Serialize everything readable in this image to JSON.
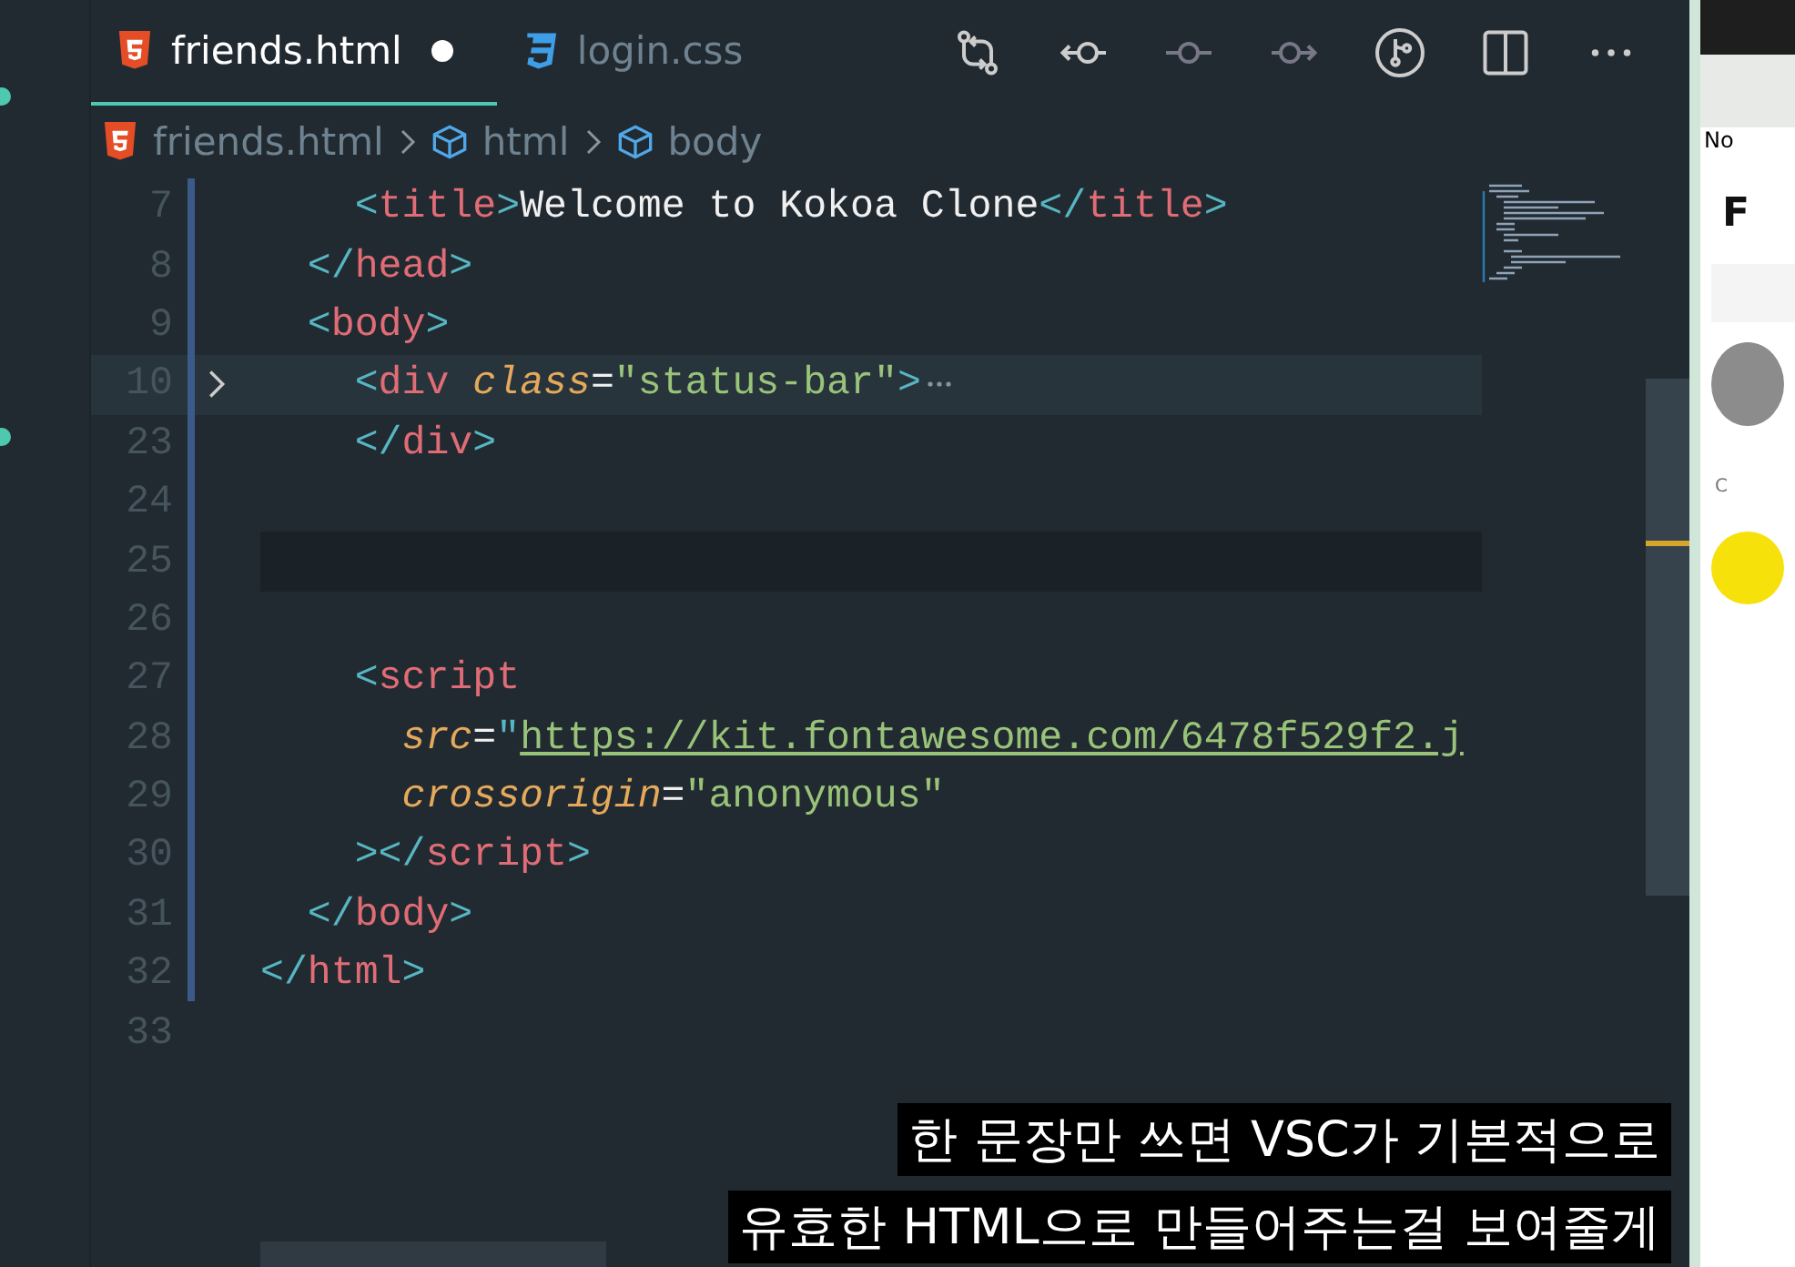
{
  "tabs": [
    {
      "label": "friends.html",
      "kind": "html",
      "selected": true,
      "dirty": true
    },
    {
      "label": "login.css",
      "kind": "css",
      "selected": false,
      "dirty": false
    }
  ],
  "breadcrumbs": [
    {
      "label": "friends.html",
      "kind": "file"
    },
    {
      "label": "html",
      "kind": "symbol"
    },
    {
      "label": "body",
      "kind": "symbol"
    }
  ],
  "lines": [
    {
      "children": [
        {
          "children": [
            {
              "number": "7",
              "folded": false,
              "current": false,
              "tokens": [
                {
                  "kind": "p",
                  "s": "<"
                },
                {
                  "kind": "tag",
                  "s": "title"
                },
                {
                  "kind": "p",
                  "s": ">"
                },
                {
                  "kind": "text",
                  "s": "Welcome to Kokoa Clone"
                },
                {
                  "kind": "p",
                  "s": "</"
                },
                {
                  "kind": "tag",
                  "s": "title"
                },
                {
                  "kind": "p",
                  "s": ">"
                }
              ]
            }
          ]
        },
        {
          "number": "8",
          "folded": false,
          "current": false,
          "tokens": [
            {
              "kind": "p",
              "s": "</"
            },
            {
              "kind": "tag",
              "s": "head"
            },
            {
              "kind": "p",
              "s": ">"
            }
          ]
        },
        {
          "number": "9",
          "folded": false,
          "current": false,
          "tokens": [
            {
              "kind": "p",
              "s": "<"
            },
            {
              "kind": "tag",
              "s": "body"
            },
            {
              "kind": "p",
              "s": ">"
            }
          ],
          "children": [
            {
              "number": "10",
              "folded": true,
              "current": false,
              "tokens": [
                {
                  "kind": "p",
                  "s": "<"
                },
                {
                  "kind": "tag",
                  "s": "div"
                },
                {
                  "kind": "attr",
                  "s": " class"
                },
                {
                  "kind": "text",
                  "s": "="
                },
                {
                  "kind": "str",
                  "s": "\"status-bar\""
                },
                {
                  "kind": "p",
                  "s": ">"
                }
              ]
            },
            {
              "number": "23",
              "folded": false,
              "current": false,
              "tokens": [
                {
                  "kind": "p",
                  "s": "</"
                },
                {
                  "kind": "tag",
                  "s": "div"
                },
                {
                  "kind": "p",
                  "s": ">"
                }
              ]
            },
            {
              "number": "24",
              "folded": false,
              "current": false
            },
            {
              "number": "25",
              "folded": false,
              "current": true
            },
            {
              "number": "26",
              "folded": false,
              "current": false
            },
            {
              "number": "27",
              "folded": false,
              "current": false,
              "tokens": [
                {
                  "kind": "p",
                  "s": "<"
                },
                {
                  "kind": "tag",
                  "s": "script"
                }
              ],
              "children": [
                {
                  "number": "28",
                  "folded": false,
                  "current": false,
                  "tokens": [
                    {
                      "kind": "attr",
                      "s": "src"
                    },
                    {
                      "kind": "text",
                      "s": "="
                    },
                    {
                      "kind": "p",
                      "s": "\""
                    },
                    {
                      "kind": "link",
                      "s": "https://kit.fontawesome.com/6478f529f2.j"
                    }
                  ]
                },
                {
                  "number": "29",
                  "folded": false,
                  "current": false,
                  "tokens": [
                    {
                      "kind": "attr",
                      "s": "crossorigin"
                    },
                    {
                      "kind": "text",
                      "s": "="
                    },
                    {
                      "kind": "str",
                      "s": "\"anonymous\""
                    }
                  ]
                }
              ]
            },
            {
              "number": "30",
              "folded": false,
              "current": false,
              "tokens": [
                {
                  "kind": "p",
                  "s": "></"
                },
                {
                  "kind": "tag",
                  "s": "script"
                },
                {
                  "kind": "p",
                  "s": ">"
                }
              ]
            }
          ]
        },
        {
          "number": "31",
          "folded": false,
          "current": false,
          "tokens": [
            {
              "kind": "p",
              "s": "</"
            },
            {
              "kind": "tag",
              "s": "body"
            },
            {
              "kind": "p",
              "s": ">"
            }
          ]
        }
      ]
    },
    {
      "number": "32",
      "folded": false,
      "current": false,
      "tokens": [
        {
          "kind": "p",
          "s": "</"
        },
        {
          "kind": "tag",
          "s": "html"
        },
        {
          "kind": "p",
          "s": ">"
        }
      ]
    },
    {
      "number": "33",
      "folded": false,
      "current": false
    }
  ],
  "browser_panel": {
    "top_label": "No",
    "heading": "F",
    "section_label": "C"
  },
  "subtitles": [
    "한 문장만 쓰면 VSC가 기본적으로",
    "유효한 HTML으로 만들어주는걸 보여줄게"
  ]
}
